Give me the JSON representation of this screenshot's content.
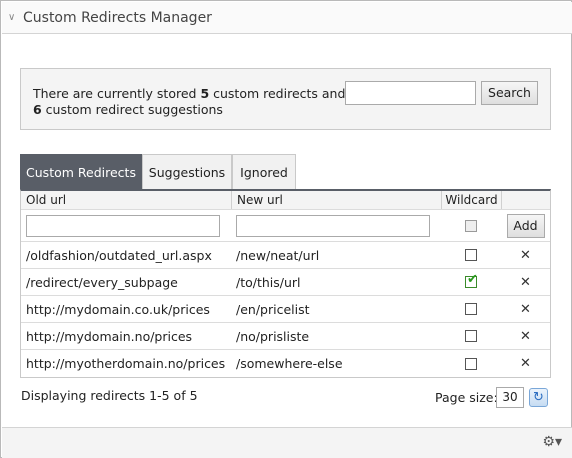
{
  "panel": {
    "title": "Custom Redirects Manager"
  },
  "info": {
    "prefix": "There are currently stored ",
    "redirect_count": "5",
    "middle": " custom redirects and",
    "suggestion_count": "6",
    "suffix": " custom redirect suggestions"
  },
  "search": {
    "value": "",
    "button_label": "Search"
  },
  "tabs": [
    {
      "label": "Custom Redirects",
      "active": true
    },
    {
      "label": "Suggestions",
      "active": false
    },
    {
      "label": "Ignored",
      "active": false
    }
  ],
  "table": {
    "headers": {
      "old_url": "Old url",
      "new_url": "New url",
      "wildcard": "Wildcard"
    },
    "add_label": "Add",
    "delete_glyph": "✕",
    "rows": [
      {
        "old_url": "/oldfashion/outdated_url.aspx",
        "new_url": "/new/neat/url",
        "wildcard": false
      },
      {
        "old_url": "/redirect/every_subpage",
        "new_url": "/to/this/url",
        "wildcard": true
      },
      {
        "old_url": "http://mydomain.co.uk/prices",
        "new_url": "/en/pricelist",
        "wildcard": false
      },
      {
        "old_url": "http://mydomain.no/prices",
        "new_url": "/no/prisliste",
        "wildcard": false
      },
      {
        "old_url": "http://myotherdomain.no/prices",
        "new_url": "/somewhere-else",
        "wildcard": false
      }
    ]
  },
  "footer": {
    "status": "Displaying redirects 1-5 of 5",
    "page_size_label": "Page size:",
    "page_size_value": "30"
  },
  "icons": {
    "collapse": "chevron-down-icon",
    "refresh": "refresh-icon",
    "settings": "gear-icon"
  },
  "colors": {
    "active_tab": "#595e67",
    "check_green": "#2a9a1e"
  }
}
